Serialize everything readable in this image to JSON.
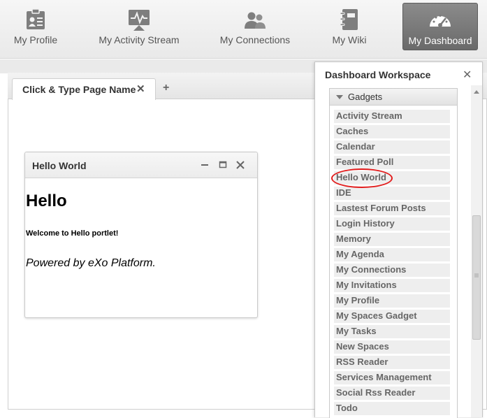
{
  "nav": {
    "profile": {
      "label": "My Profile",
      "icon": "profile-card-icon"
    },
    "activity": {
      "label": "My Activity Stream",
      "icon": "activity-stream-icon"
    },
    "connections": {
      "label": "My Connections",
      "icon": "connections-icon"
    },
    "wiki": {
      "label": "My Wiki",
      "icon": "wiki-notebook-icon"
    },
    "dashboard": {
      "label": "My Dashboard",
      "icon": "dashboard-gauge-icon",
      "active": true
    }
  },
  "page_tab": {
    "label": "Click & Type Page Name",
    "close_glyph": "✕",
    "add_glyph": "+"
  },
  "gadget": {
    "title": "Hello World",
    "heading": "Hello",
    "welcome": "Welcome to Hello portlet!",
    "powered": "Powered by eXo Platform."
  },
  "workspace": {
    "title": "Dashboard Workspace",
    "close_glyph": "✕",
    "category": "Gadgets",
    "items": [
      "Activity Stream",
      "Caches",
      "Calendar",
      "Featured Poll",
      "Hello World",
      "IDE",
      "Lastest Forum Posts",
      "Login History",
      "Memory",
      "My Agenda",
      "My Connections",
      "My Invitations",
      "My Profile",
      "My Spaces Gadget",
      "My Tasks",
      "New Spaces",
      "RSS Reader",
      "Services Management",
      "Social Rss Reader",
      "Todo"
    ],
    "highlighted_item": "Hello World"
  },
  "colors": {
    "highlight_ring": "#e21b1b",
    "active_nav": "#7a7a7a"
  }
}
